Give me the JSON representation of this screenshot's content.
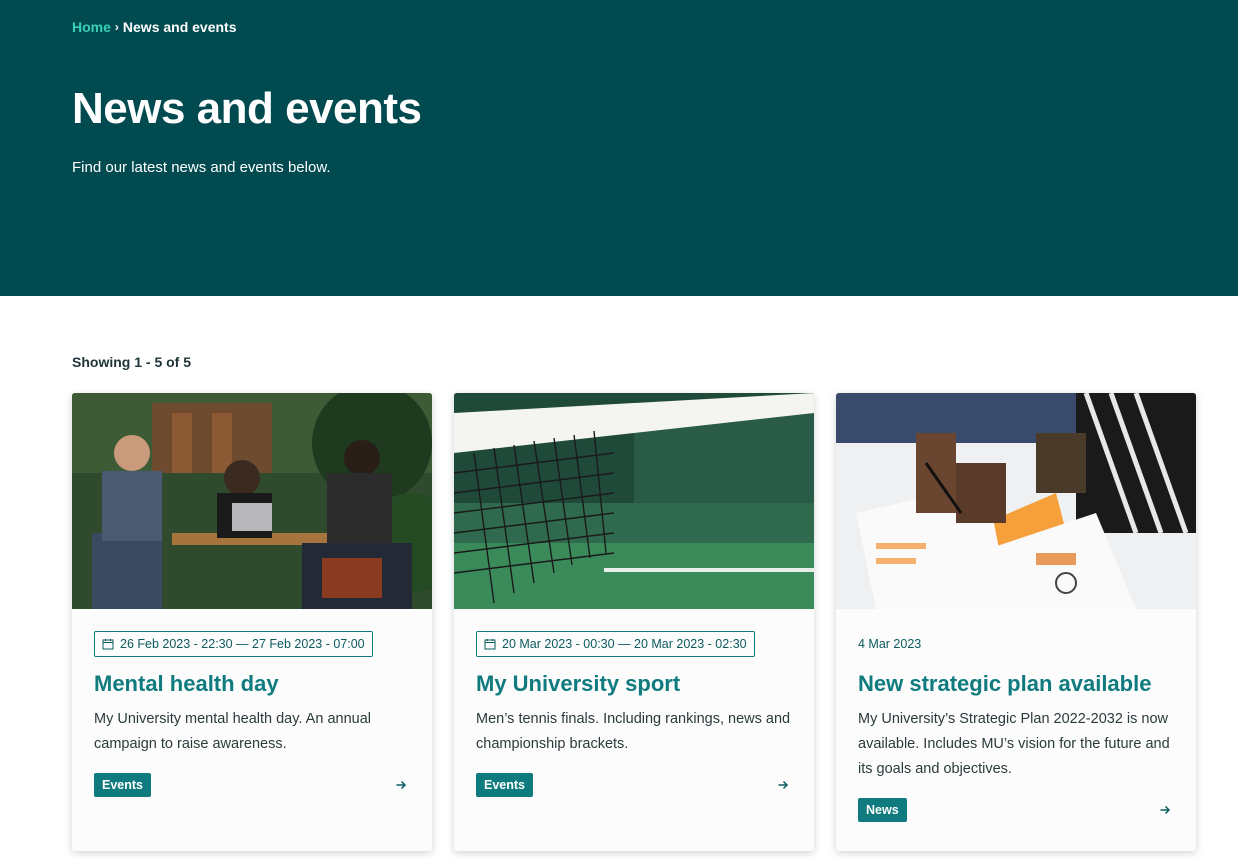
{
  "breadcrumb": {
    "home": "Home",
    "separator": "›",
    "current": "News and events"
  },
  "hero": {
    "title": "News and events",
    "intro": "Find our latest news and events below."
  },
  "results": {
    "summary": "Showing 1 - 5 of 5"
  },
  "cards": [
    {
      "date": "26 Feb 2023 - 22:30 — 27 Feb 2023 - 07:00",
      "date_icon": "calendar-icon",
      "title": "Mental health day",
      "description": "My University mental health day. An annual campaign to raise awareness.",
      "tag": "Events"
    },
    {
      "date": "20 Mar 2023 - 00:30 — 20 Mar 2023 - 02:30",
      "date_icon": "calendar-icon",
      "title": "My University sport",
      "description": "Men’s tennis finals. Including rankings, news and championship brackets.",
      "tag": "Events"
    },
    {
      "date": "4 Mar 2023",
      "title": "New strategic plan available",
      "description": "My University’s Strategic Plan 2022-2032 is now available. Includes MU’s vision for the future and its goals and objectives.",
      "tag": "News"
    }
  ],
  "colors": {
    "hero_bg": "#004a50",
    "accent": "#0f7b7e",
    "breadcrumb_link": "#38d0b8"
  }
}
